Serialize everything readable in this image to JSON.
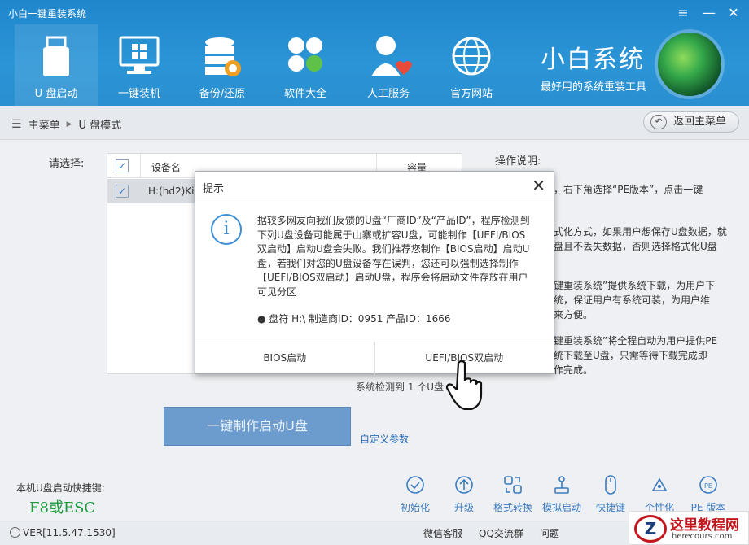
{
  "app": {
    "title": "小白一键重装系统",
    "minimize": "≡",
    "close": "✕"
  },
  "nav": {
    "tabs": [
      {
        "label": "U 盘启动",
        "icon": "usb-drive-icon"
      },
      {
        "label": "一键装机",
        "icon": "monitor-windows-icon"
      },
      {
        "label": "备份/还原",
        "icon": "database-backup-icon"
      },
      {
        "label": "软件大全",
        "icon": "apps-grid-icon"
      },
      {
        "label": "人工服务",
        "icon": "person-heart-icon"
      },
      {
        "label": "官方网站",
        "icon": "globe-icon"
      }
    ]
  },
  "brand": {
    "name": "小白系统",
    "subtitle": "最好用的系统重装工具"
  },
  "breadcrumb": {
    "root": "主菜单",
    "sep": "▶",
    "current": "U 盘模式",
    "back_label": "返回主菜单"
  },
  "main": {
    "choose_label": "请选择:",
    "table": {
      "col_device": "设备名",
      "col_capacity": "容量",
      "rows": [
        {
          "device": "H:(hd2)Ki",
          "checked": true
        }
      ]
    },
    "scan_status": "系统检测到 1 个U盘",
    "make_button": "一键制作启动U盘",
    "custom_link": "自定义参数"
  },
  "help": {
    "title": "操作说明:",
    "p1": "，右下角选择“PE版本”，点击一键",
    "p2": "式化方式，如果用户想保存U盘数据，就\n盘且不丢失数据，否则选择格式化U盘",
    "p3": "键重装系统”提供系统下载，为用户下\n统，保证用户有系统可装，为用户维\n来方便。",
    "p4": "键重装系统”将全程自动为用户提供PE\n统下载至U盘，只需等待下载完成即\n作完成。"
  },
  "bottom": {
    "hotkey_label": "本机U盘启动快捷键:",
    "hotkey_value": "F8或ESC",
    "tools": [
      "初始化",
      "升级",
      "格式转换",
      "模拟启动",
      "快捷键",
      "个性化",
      "PE 版本"
    ]
  },
  "footer": {
    "version": "VER[11.5.47.1530]",
    "links": [
      "微信客服",
      "QQ交流群",
      "问题"
    ]
  },
  "watermark": {
    "title": "这里教程网",
    "site": "herecours.com",
    "logo_letter": "Z"
  },
  "dialog": {
    "title": "提示",
    "close": "✕",
    "message": "据较多网友向我们反馈的U盘“厂商ID”及“产品ID”，程序检测到下列U盘设备可能属于山寨或扩容U盘，可能制作【UEFI/BIOS双启动】启动U盘会失败。我们推荐您制作【BIOS启动】启动U盘，若我们对您的U盘设备存在误判，您还可以强制选择制作【UEFI/BIOS双启动】启动U盘，程序会将启动文件存放在用户可见分区",
    "device_line": "● 盘符 H:\\ 制造商ID：0951 产品ID：1666",
    "btn_bios": "BIOS启动",
    "btn_uefi": "UEFI/BIOS双启动"
  }
}
